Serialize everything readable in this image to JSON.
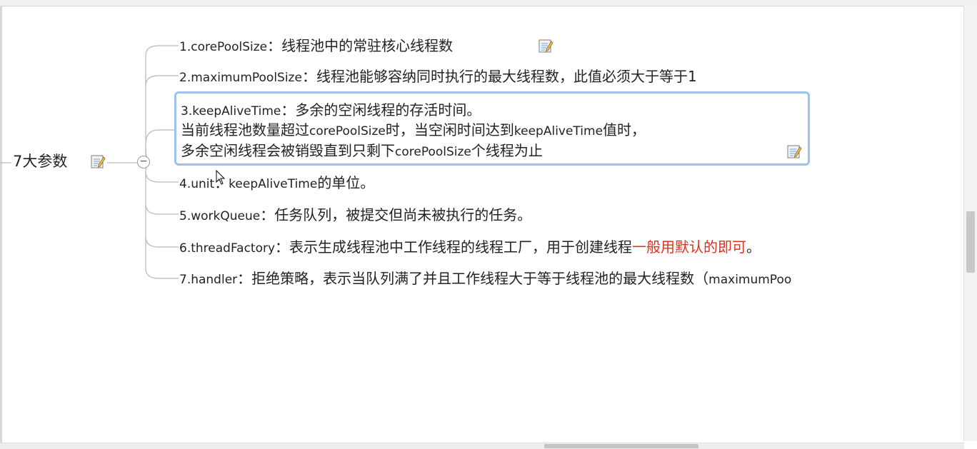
{
  "root": {
    "label": "7大参数"
  },
  "collapse": {
    "label": "−"
  },
  "topics": [
    {
      "key": "1.corePoolSize",
      "sep": "：",
      "text": "线程池中的常驻核心线程数"
    },
    {
      "key": "2.maximumPoolSize",
      "sep": "：",
      "text": "线程池能够容纳同时执行的最大线程数，此值必须大于等于1"
    },
    {
      "key": "4.unit",
      "sep": "：",
      "text_key": "keepAliveTime",
      "text": "的单位。"
    },
    {
      "key": "5.workQueue",
      "sep": "：",
      "text": "任务队列，被提交但尚未被执行的任务。"
    },
    {
      "key": "6.threadFactory",
      "sep": "：",
      "text": "表示生成线程池中工作线程的线程工厂，用于创建线程",
      "red": "一般用默认的即可",
      "tail": "。"
    },
    {
      "key": "7.handler",
      "sep": "：",
      "text": "拒绝策略，表示当队列满了并且工作线程大于等于线程池的最大线程数（",
      "text_key": "maximumPoo"
    }
  ],
  "selected_topic": {
    "line1_key": "3.keepAliveTime",
    "line1_text": "：多余的空闲线程的存活时间。",
    "line2_a": "当前线程池数量超过",
    "line2_key1": "corePoolSize",
    "line2_b": "时，当空闲时间达到",
    "line2_key2": "keepAliveTime",
    "line2_c": "值时，",
    "line3_a": "多余空闲线程会被销毁直到只剩下",
    "line3_key": "corePoolSize",
    "line3_b": "个线程为止"
  },
  "colors": {
    "connector": "#b9b9b9",
    "selection_border": "#9dc3ec",
    "highlight_red": "#e0301e"
  },
  "icons": {
    "note": "note-pencil-icon",
    "cursor": "mouse-pointer-icon"
  }
}
